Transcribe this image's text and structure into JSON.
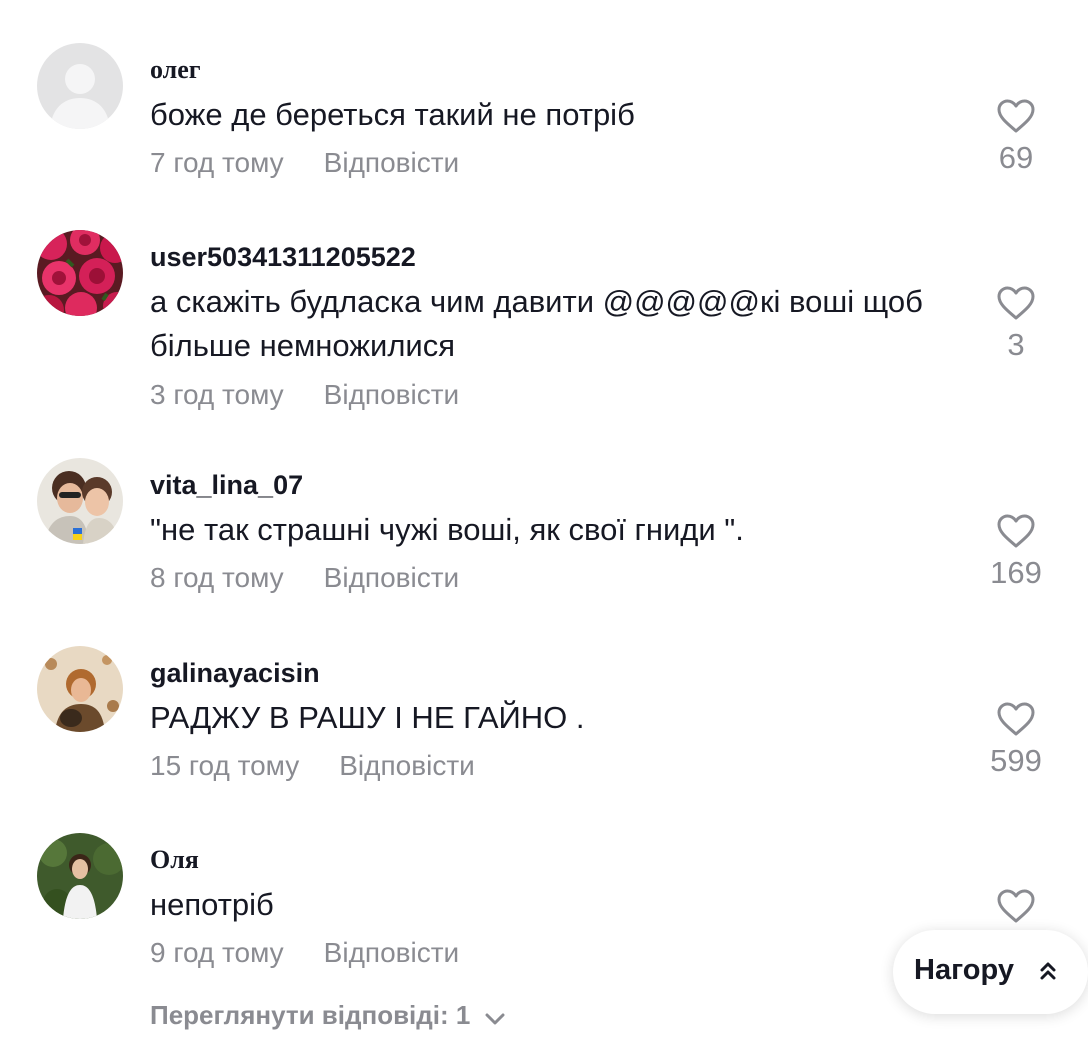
{
  "comments": [
    {
      "username": "олег",
      "text": "боже де береться такий не потріб",
      "time": "7 год тому",
      "reply": "Відповісти",
      "likes": "69",
      "avatar_icon": "default-avatar"
    },
    {
      "username": "user50341311205522",
      "text": "а скажіть будласка чим давити @@@@@кі воші щоб більше немножилися",
      "time": "3 год тому",
      "reply": "Відповісти",
      "likes": "3",
      "avatar_icon": "roses-photo"
    },
    {
      "username": "vita_lina_07",
      "text": "\"не так страшні чужі воші, як свої гниди \".",
      "time": "8 год тому",
      "reply": "Відповісти",
      "likes": "169",
      "avatar_icon": "two-women-photo"
    },
    {
      "username": "galinayacisin",
      "text": "РАДЖУ В РАШУ І НЕ ГАЙНО .",
      "time": "15 год тому",
      "reply": "Відповісти",
      "likes": "599",
      "avatar_icon": "woman-with-dog-photo"
    },
    {
      "username": "Оля",
      "text": "непотріб",
      "time": "9 год тому",
      "reply": "Відповісти",
      "likes": "",
      "avatar_icon": "woman-in-green-photo"
    }
  ],
  "view_replies": "Переглянути відповіді: 1",
  "back_to_top": "Нагору",
  "colors": {
    "text": "#161823",
    "muted": "#8a8b91"
  }
}
